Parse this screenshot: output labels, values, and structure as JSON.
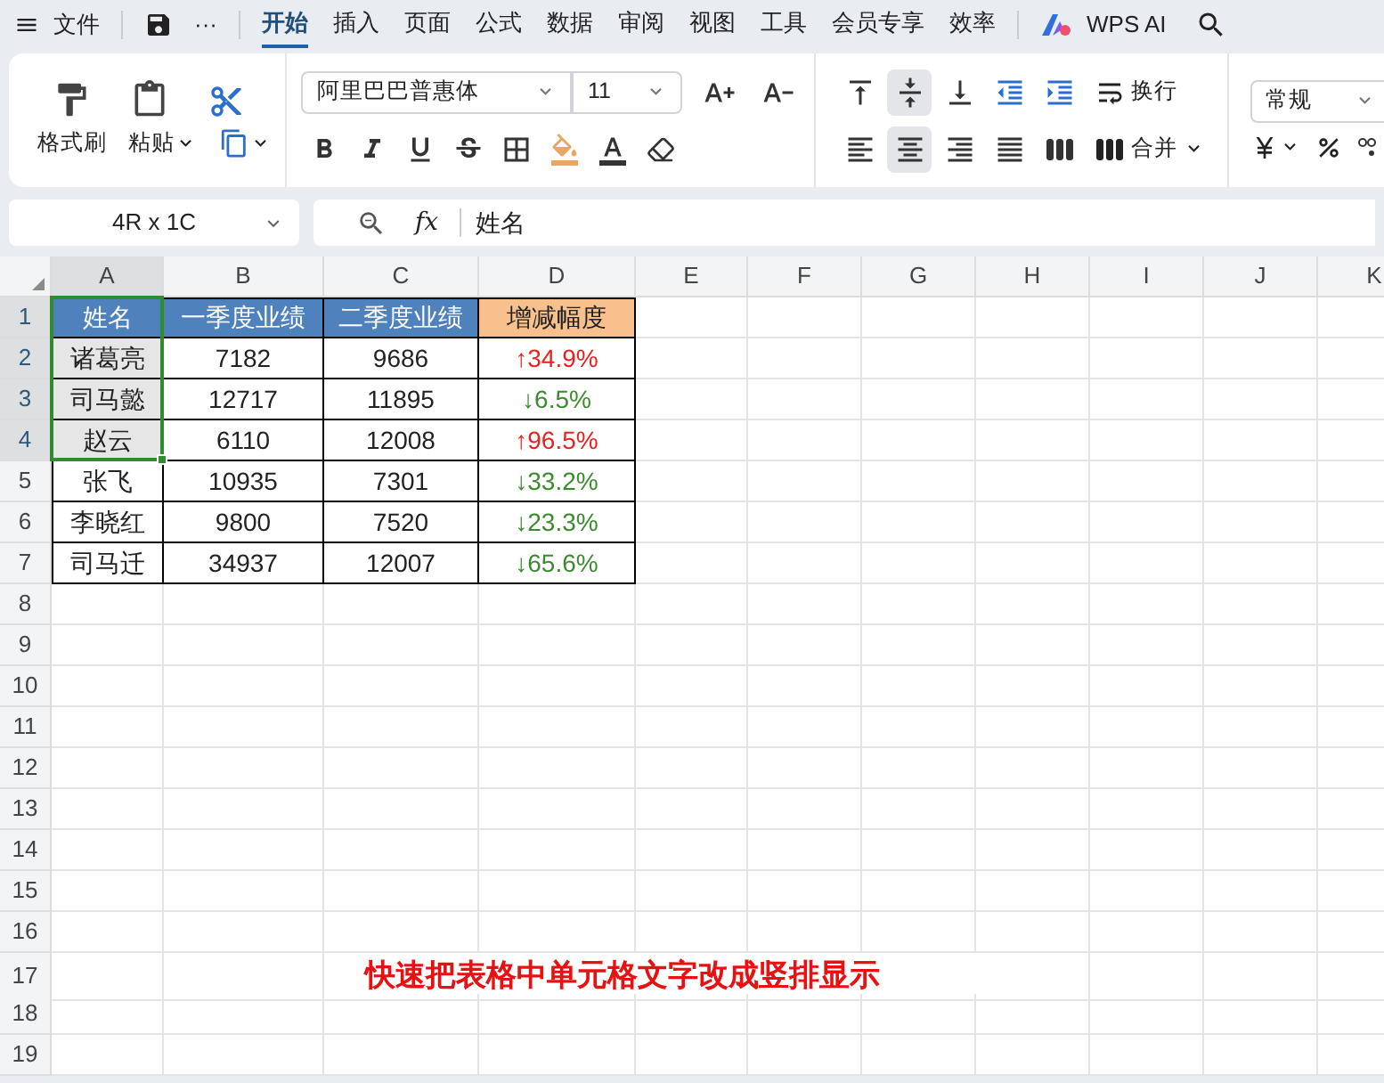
{
  "menu_bar": {
    "file": "文件",
    "more": "···",
    "tabs": [
      {
        "label": "开始",
        "selected": true
      },
      {
        "label": "插入",
        "selected": false
      },
      {
        "label": "页面",
        "selected": false
      },
      {
        "label": "公式",
        "selected": false
      },
      {
        "label": "数据",
        "selected": false
      },
      {
        "label": "审阅",
        "selected": false
      },
      {
        "label": "视图",
        "selected": false
      },
      {
        "label": "工具",
        "selected": false
      },
      {
        "label": "会员专享",
        "selected": false
      },
      {
        "label": "效率",
        "selected": false
      }
    ],
    "ai": "WPS AI"
  },
  "ribbon": {
    "format_painter": "格式刷",
    "paste": "粘贴",
    "font_name": "阿里巴巴普惠体",
    "font_size": "11",
    "wrap": "换行",
    "merge": "合并",
    "number_format": "常规"
  },
  "formula_bar": {
    "name_box": "4R x 1C",
    "fx": "fx",
    "value": "姓名"
  },
  "sheet": {
    "columns": [
      {
        "label": "A",
        "selected": true
      },
      {
        "label": "B",
        "selected": false
      },
      {
        "label": "C",
        "selected": false
      },
      {
        "label": "D",
        "selected": false
      },
      {
        "label": "E",
        "selected": false
      },
      {
        "label": "F",
        "selected": false
      },
      {
        "label": "G",
        "selected": false
      },
      {
        "label": "H",
        "selected": false
      },
      {
        "label": "I",
        "selected": false
      },
      {
        "label": "J",
        "selected": false
      },
      {
        "label": "K",
        "selected": false
      }
    ],
    "rows": [
      {
        "label": "1",
        "selected": true,
        "kind": "header",
        "cells": [
          {
            "text": "姓名",
            "color": "#4f81bd"
          },
          {
            "text": "一季度业绩",
            "color": "#4f81bd"
          },
          {
            "text": "二季度业绩",
            "color": "#4f81bd"
          },
          {
            "text": "增减幅度",
            "color": "#f8c08c"
          }
        ]
      },
      {
        "label": "2",
        "selected": true,
        "kind": "data",
        "cells": [
          {
            "text": "诸葛亮"
          },
          {
            "text": "7182"
          },
          {
            "text": "9686"
          },
          {
            "text": "↑34.9%",
            "color": "#e8201e"
          }
        ]
      },
      {
        "label": "3",
        "selected": true,
        "kind": "data",
        "cells": [
          {
            "text": "司马懿"
          },
          {
            "text": "12717"
          },
          {
            "text": "11895"
          },
          {
            "text": "↓6.5%",
            "color": "#3c8a2e"
          }
        ]
      },
      {
        "label": "4",
        "selected": true,
        "kind": "data",
        "cells": [
          {
            "text": "赵云"
          },
          {
            "text": "6110"
          },
          {
            "text": "12008"
          },
          {
            "text": "↑96.5%",
            "color": "#e8201e"
          }
        ]
      },
      {
        "label": "5",
        "selected": false,
        "kind": "data",
        "cells": [
          {
            "text": "张飞"
          },
          {
            "text": "10935"
          },
          {
            "text": "7301"
          },
          {
            "text": "↓33.2%",
            "color": "#3c8a2e"
          }
        ]
      },
      {
        "label": "6",
        "selected": false,
        "kind": "data",
        "cells": [
          {
            "text": "李晓红"
          },
          {
            "text": "9800"
          },
          {
            "text": "7520"
          },
          {
            "text": "↓23.3%",
            "color": "#3c8a2e"
          }
        ]
      },
      {
        "label": "7",
        "selected": false,
        "kind": "data",
        "cells": [
          {
            "text": "司马迁"
          },
          {
            "text": "34937"
          },
          {
            "text": "12007"
          },
          {
            "text": "↓65.6%",
            "color": "#3c8a2e"
          }
        ]
      },
      {
        "label": "8",
        "selected": false,
        "kind": "empty"
      },
      {
        "label": "9",
        "selected": false,
        "kind": "empty"
      },
      {
        "label": "10",
        "selected": false,
        "kind": "empty"
      },
      {
        "label": "11",
        "selected": false,
        "kind": "empty"
      },
      {
        "label": "12",
        "selected": false,
        "kind": "empty"
      },
      {
        "label": "13",
        "selected": false,
        "kind": "empty"
      },
      {
        "label": "14",
        "selected": false,
        "kind": "empty"
      },
      {
        "label": "15",
        "selected": false,
        "kind": "empty"
      },
      {
        "label": "16",
        "selected": false,
        "kind": "empty"
      },
      {
        "label": "17",
        "selected": false,
        "kind": "caption",
        "text": "快速把表格中单元格文字改成竖排显示"
      },
      {
        "label": "18",
        "selected": false,
        "kind": "empty"
      },
      {
        "label": "19",
        "selected": false,
        "kind": "empty"
      }
    ]
  }
}
